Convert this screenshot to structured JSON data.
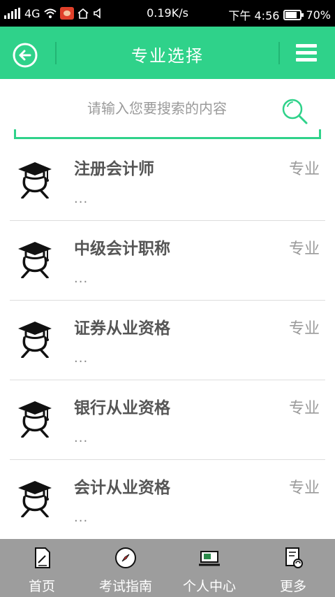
{
  "status_bar": {
    "network": "4G",
    "speed": "0.19K/s",
    "time": "下午 4:56",
    "battery": "70%"
  },
  "header": {
    "title": "专业选择",
    "back_icon": "back-arrow-circle-icon",
    "menu_icon": "hamburger-menu-icon"
  },
  "search": {
    "placeholder": "请输入您要搜索的内容",
    "value": "",
    "icon": "search-icon"
  },
  "items": [
    {
      "title": "注册会计师",
      "subtitle": "...",
      "tag": "专业",
      "icon": "graduate-cap-icon"
    },
    {
      "title": "中级会计职称",
      "subtitle": "...",
      "tag": "专业",
      "icon": "graduate-cap-icon"
    },
    {
      "title": "证券从业资格",
      "subtitle": "...",
      "tag": "专业",
      "icon": "graduate-cap-icon"
    },
    {
      "title": "银行从业资格",
      "subtitle": "...",
      "tag": "专业",
      "icon": "graduate-cap-icon"
    },
    {
      "title": "会计从业资格",
      "subtitle": "...",
      "tag": "专业",
      "icon": "graduate-cap-icon"
    }
  ],
  "bottom_nav": [
    {
      "label": "首页",
      "icon": "document-icon"
    },
    {
      "label": "考试指南",
      "icon": "compass-icon"
    },
    {
      "label": "个人中心",
      "icon": "laptop-icon"
    },
    {
      "label": "更多",
      "icon": "more-clipboard-icon"
    }
  ],
  "colors": {
    "accent": "#2fd28a",
    "nav_bg": "#9d9d9d"
  }
}
